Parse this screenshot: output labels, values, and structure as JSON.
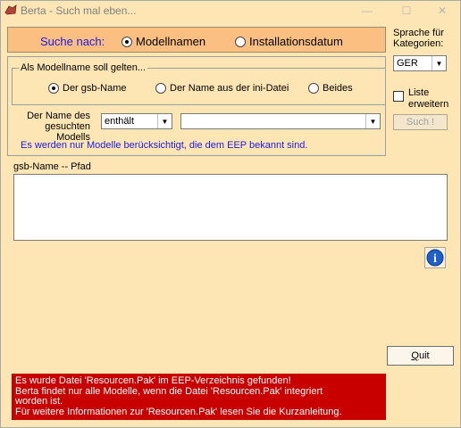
{
  "window": {
    "title": "Berta - Such mal eben...",
    "min_glyph": "—",
    "max_glyph": "☐",
    "close_glyph": "✕"
  },
  "search_mode": {
    "label": "Suche nach:",
    "options": [
      "Modellnamen",
      "Installationsdatum"
    ],
    "selected": "Modellnamen"
  },
  "language": {
    "label_line1": "Sprache für",
    "label_line2": "Kategorien:",
    "value": "GER"
  },
  "list_extend": {
    "label_line1": "Liste",
    "label_line2": "erweitern",
    "checked": false
  },
  "search_button": {
    "label": "Such !",
    "enabled": false
  },
  "model_name_group": {
    "caption": "Als Modellname soll gelten...",
    "options": [
      "Der gsb-Name",
      "Der Name aus der ini-Datei",
      "Beides"
    ],
    "selected": "Der gsb-Name"
  },
  "model_filter": {
    "label_line1": "Der Name des",
    "label_line2": "gesuchten Modells",
    "match_value": "enthält",
    "name_value": "",
    "notice": "Es werden nur Modelle berücksichtigt, die dem EEP bekannt sind."
  },
  "results": {
    "caption": "gsb-Name -- Pfad",
    "rows": []
  },
  "info_button": {
    "glyph": "i"
  },
  "quit_button": {
    "label_first": "Q",
    "label_rest": "uit"
  },
  "warning": {
    "lines": [
      "Es wurde Datei 'Resourcen.Pak' im EEP-Verzeichnis gefunden!",
      "Berta findet nur alle Modelle, wenn die Datei 'Resourcen.Pak' integriert",
      "worden ist.",
      "Für weitere Informationen zur 'Resourcen.Pak' lesen Sie die Kurzanleitung."
    ]
  },
  "colors": {
    "window_bg": "#fde5b4",
    "strip_bg": "#fbbf81",
    "accent_text": "#1a1ae6",
    "warning_bg": "#c80000"
  },
  "icons": {
    "app": "berta-app-icon",
    "info": "info-icon",
    "dropdown": "chevron-down-icon"
  }
}
